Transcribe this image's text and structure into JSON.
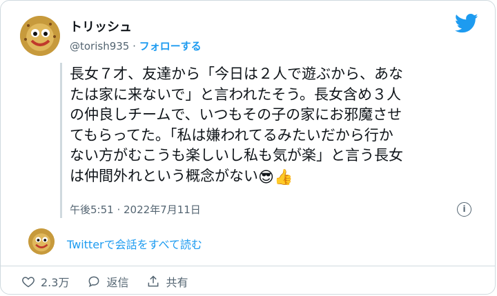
{
  "tweet": {
    "author_name": "トリッシュ",
    "handle": "@torish935",
    "separator": " · ",
    "follow_label": "フォローする",
    "lines": [
      "長女７才、友達から「今日は２人で遊ぶから、あな",
      "たは家に来ないで」と言われたそう。長女含め３人",
      "の仲良しチームで、いつもその子の家にお邪魔させ",
      "てもらってた。「私は嫌われてるみたいだから行か",
      "ない方がむこうも楽しいし私も気が楽」と言う長女",
      "は仲間外れという概念がない"
    ],
    "emojis": [
      "😎",
      "👍"
    ],
    "timestamp": "午後5:51 · 2022年7月11日",
    "info_label": "i",
    "conversation_link": "Twitterで会話をすべて読む"
  },
  "actions": [
    {
      "icon": "heart-icon",
      "label": "2.3万"
    },
    {
      "icon": "reply-icon",
      "label": "返信"
    },
    {
      "icon": "share-icon",
      "label": "共有"
    }
  ],
  "colors": {
    "accent": "#1d9bf0",
    "text": "#0f1419",
    "muted": "#536471",
    "border": "#cfd9de"
  }
}
